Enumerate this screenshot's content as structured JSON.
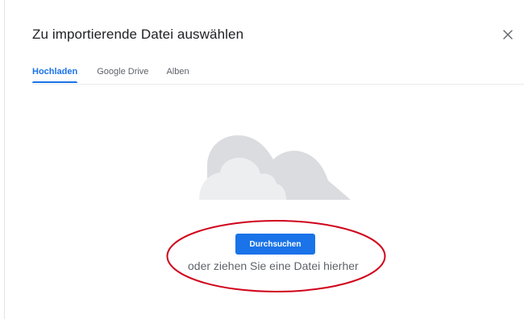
{
  "dialog": {
    "title": "Zu importierende Datei auswählen",
    "close_icon": "close-icon"
  },
  "tabs": [
    {
      "label": "Hochladen",
      "active": true
    },
    {
      "label": "Google Drive",
      "active": false
    },
    {
      "label": "Alben",
      "active": false
    }
  ],
  "upload": {
    "illustration_icon": "cloud-icon",
    "browse_label": "Durchsuchen",
    "drop_hint": "oder ziehen Sie eine Datei hierher"
  },
  "colors": {
    "accent": "#1a73e8",
    "annotation": "#d0021b",
    "cloud_back": "#dadce0",
    "cloud_front": "#eceef0"
  }
}
